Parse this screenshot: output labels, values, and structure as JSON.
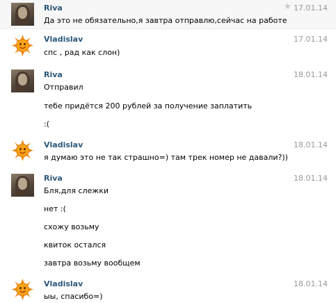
{
  "messages": [
    {
      "author": "Riva",
      "date": "17.01.14",
      "lines": [
        "Да это не обязательно,я завтра отправлю,сейчас на работе"
      ]
    },
    {
      "author": "Vladislav",
      "date": "17.01.14",
      "lines": [
        "спс , рад как слон)"
      ]
    },
    {
      "author": "Riva",
      "date": "18.01.14",
      "lines": [
        "Отправил",
        "тебе придётся 200 рублей за получение заплатить",
        ":("
      ]
    },
    {
      "author": "Vladislav",
      "date": "18.01.14",
      "lines": [
        "я думаю это не так страшно=) там трек номер не давали?))"
      ]
    },
    {
      "author": "Riva",
      "date": "18.01.14",
      "lines": [
        "Бля,для слежки",
        "нет :(",
        "схожу возьму",
        "квиток остался",
        "завтра возьму вообщем"
      ]
    },
    {
      "author": "Vladislav",
      "date": "18.01.14",
      "lines": [
        "ыы, спасибо=)"
      ]
    }
  ],
  "icons": {
    "star": "star-icon",
    "riva_avatar": "avatar-photo",
    "vladislav_avatar": "sun-avatar"
  },
  "colors": {
    "author_name": "#2b587a",
    "date": "#999999",
    "alt_background": "#f7f7f7"
  }
}
